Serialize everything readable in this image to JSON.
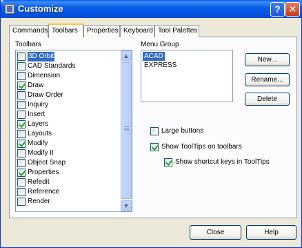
{
  "window": {
    "title": "Customize",
    "help_glyph": "?",
    "close_glyph": "✕"
  },
  "tabs": [
    {
      "label": "Commands",
      "active": false
    },
    {
      "label": "Toolbars",
      "active": true
    },
    {
      "label": "Properties",
      "active": false
    },
    {
      "label": "Keyboard",
      "active": false
    },
    {
      "label": "Tool Palettes",
      "active": false
    }
  ],
  "toolbars": {
    "label": "Toolbars",
    "items": [
      {
        "label": "3D Orbit",
        "checked": false,
        "selected": true
      },
      {
        "label": "CAD Standards",
        "checked": false,
        "selected": false
      },
      {
        "label": "Dimension",
        "checked": false,
        "selected": false
      },
      {
        "label": "Draw",
        "checked": true,
        "selected": false
      },
      {
        "label": "Draw Order",
        "checked": false,
        "selected": false
      },
      {
        "label": "Inquiry",
        "checked": false,
        "selected": false
      },
      {
        "label": "Insert",
        "checked": false,
        "selected": false
      },
      {
        "label": "Layers",
        "checked": true,
        "selected": false
      },
      {
        "label": "Layouts",
        "checked": false,
        "selected": false
      },
      {
        "label": "Modify",
        "checked": true,
        "selected": false
      },
      {
        "label": "Modify II",
        "checked": false,
        "selected": false
      },
      {
        "label": "Object Snap",
        "checked": false,
        "selected": false
      },
      {
        "label": "Properties",
        "checked": true,
        "selected": false
      },
      {
        "label": "Refedit",
        "checked": false,
        "selected": false
      },
      {
        "label": "Reference",
        "checked": false,
        "selected": false
      },
      {
        "label": "Render",
        "checked": false,
        "selected": false
      }
    ]
  },
  "menu_group": {
    "label": "Menu Group",
    "items": [
      {
        "label": "ACAD",
        "selected": true
      },
      {
        "label": "EXPRESS",
        "selected": false
      }
    ]
  },
  "buttons": {
    "new": "New...",
    "rename": "Rename...",
    "delete": "Delete",
    "close": "Close",
    "help": "Help"
  },
  "options": {
    "large_buttons": {
      "label": "Large buttons",
      "checked": false
    },
    "show_tooltips": {
      "label": "Show ToolTips on toolbars",
      "checked": true
    },
    "show_shortcut_keys": {
      "label": "Show shortcut keys in ToolTips",
      "checked": true
    }
  },
  "scrollbar": {
    "up_glyph": "▲",
    "down_glyph": "▼"
  }
}
